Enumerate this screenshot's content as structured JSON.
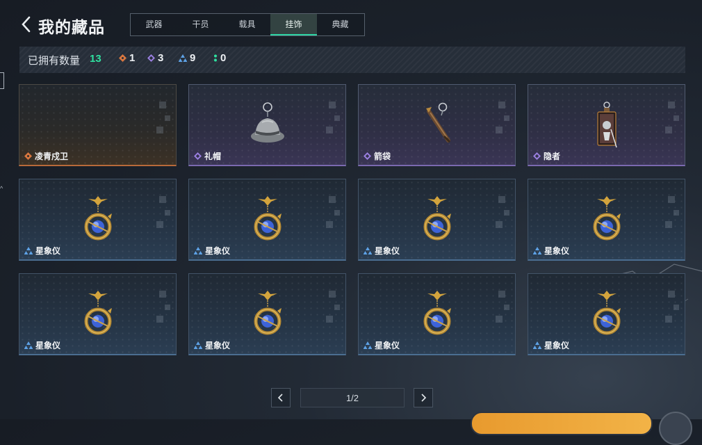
{
  "header": {
    "title": "我的藏品",
    "tabs": [
      {
        "label": "武器",
        "active": false
      },
      {
        "label": "干员",
        "active": false
      },
      {
        "label": "载具",
        "active": false
      },
      {
        "label": "挂饰",
        "active": true
      },
      {
        "label": "典藏",
        "active": false
      }
    ]
  },
  "owned": {
    "label": "已拥有数量",
    "total": "13",
    "rarities": [
      {
        "rarity": "orange",
        "count": "1",
        "color": "#d9773f"
      },
      {
        "rarity": "purple",
        "count": "3",
        "color": "#9a7fe0"
      },
      {
        "rarity": "blue",
        "count": "9",
        "color": "#5ea2e6"
      },
      {
        "rarity": "green",
        "count": "0",
        "color": "#2fe09f"
      }
    ]
  },
  "items": [
    {
      "name": "凌青戍卫",
      "rarity": "orange",
      "icon": "empty"
    },
    {
      "name": "礼帽",
      "rarity": "purple",
      "icon": "hat-charm-icon"
    },
    {
      "name": "箭袋",
      "rarity": "purple",
      "icon": "quiver-charm-icon"
    },
    {
      "name": "隐者",
      "rarity": "purple",
      "icon": "hermit-card-charm-icon"
    },
    {
      "name": "星象仪",
      "rarity": "blue",
      "icon": "astrolabe-charm-icon"
    },
    {
      "name": "星象仪",
      "rarity": "blue",
      "icon": "astrolabe-charm-icon"
    },
    {
      "name": "星象仪",
      "rarity": "blue",
      "icon": "astrolabe-charm-icon"
    },
    {
      "name": "星象仪",
      "rarity": "blue",
      "icon": "astrolabe-charm-icon"
    },
    {
      "name": "星象仪",
      "rarity": "blue",
      "icon": "astrolabe-charm-icon"
    },
    {
      "name": "星象仪",
      "rarity": "blue",
      "icon": "astrolabe-charm-icon"
    },
    {
      "name": "星象仪",
      "rarity": "blue",
      "icon": "astrolabe-charm-icon"
    },
    {
      "name": "星象仪",
      "rarity": "blue",
      "icon": "astrolabe-charm-icon"
    }
  ],
  "pagination": {
    "page": "1/2"
  }
}
